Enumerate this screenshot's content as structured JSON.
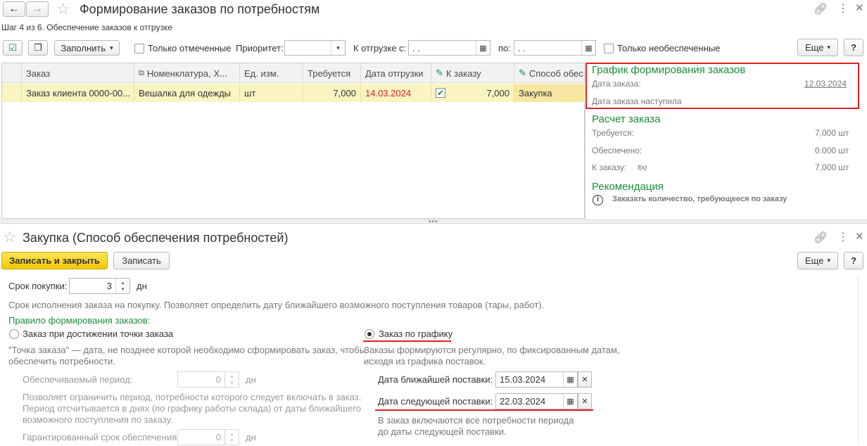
{
  "top_window": {
    "title": "Формирование заказов по потребностям",
    "step_text": "Шаг 4 из 6. Обеспечение заказов к отгрузке",
    "toolbar": {
      "fill_label": "Заполнить",
      "only_marked_label": "Только отмеченные",
      "priority_label": "Приоритет:",
      "priority_value": "",
      "ship_from_label": "К отгрузке с:",
      "ship_from_value": " .  .",
      "to_label": "по:",
      "to_value": " .  .",
      "only_unsecured_label": "Только необеспеченные",
      "more_label": "Еще",
      "help_label": "?"
    },
    "grid": {
      "columns": [
        "Заказ",
        "Номенклатура, Х...",
        "Ед. изм.",
        "Требуется",
        "Дата отгрузки",
        "К заказу",
        "Способ обес"
      ],
      "row": {
        "order": "Заказ клиента 0000-00...",
        "item": "Вешалка для одежды",
        "unit": "шт",
        "required": "7,000",
        "ship_date": "14.03.2024",
        "to_order_checked": true,
        "to_order": "7,000",
        "method": "Закупка"
      }
    },
    "side_panel": {
      "schedule_title": "График формирования заказов",
      "order_date_label": "Дата заказа:",
      "order_date_value": "12.03.2024",
      "order_date_note": "Дата заказа наступила",
      "calc_title": "Расчет заказа",
      "required_label": "Требуется:",
      "required_value": "7,000 шт",
      "secured_label": "Обеспечено:",
      "secured_value": "0.000 шт",
      "to_order_label": "К заказу:",
      "to_order_formula": "f(x)",
      "to_order_value": "7,000 шт",
      "recommend_title": "Рекомендация",
      "recommend_text": "Заказать количество, требующееся по заказу"
    }
  },
  "bottom_window": {
    "title": "Закупка (Способ обеспечения потребностей)",
    "save_close_label": "Записать и закрыть",
    "save_label": "Записать",
    "more_label": "Еще",
    "help_label": "?",
    "purchase_term_label": "Срок покупки:",
    "purchase_term_value": "3",
    "days_unit": "дн",
    "purchase_term_note": "Срок исполнения заказа на покупку. Позволяет определить дату ближайшего возможного поступления товаров (тары, работ).",
    "rule_label": "Правило формирования заказов:",
    "option_point": "Заказ при достижении точки заказа",
    "option_schedule": "Заказ по графику",
    "point_note_1": "\"Точка заказа\" — дата, не позднее которой необходимо сформировать заказ, чтобы",
    "point_note_2": "обеспечить потребности.",
    "schedule_note_1": "Заказы формируются регулярно, по фиксированным датам,",
    "schedule_note_2": "исходя из графика поставок.",
    "secured_period_label": "Обеспечиваемый период:",
    "secured_period_value": "0",
    "period_note_1": "Позволяет ограничить период, потребности которого следует включать в заказ.",
    "period_note_2": "Период отсчитывается в днях (по графику работы склада) от даты ближайшего",
    "period_note_3": "возможного поступления по заказу.",
    "guaranteed_label": "Гарантированный срок обеспечения:",
    "guaranteed_value": "0",
    "nearest_delivery_label": "Дата ближайшей поставки:",
    "nearest_delivery_value": "15.03.2024",
    "next_delivery_label": "Дата следующей поставки:",
    "next_delivery_value": "22.03.2024",
    "delivery_note_1": "В заказ включаются все потребности периода",
    "delivery_note_2": "до даты следующей поставки."
  }
}
